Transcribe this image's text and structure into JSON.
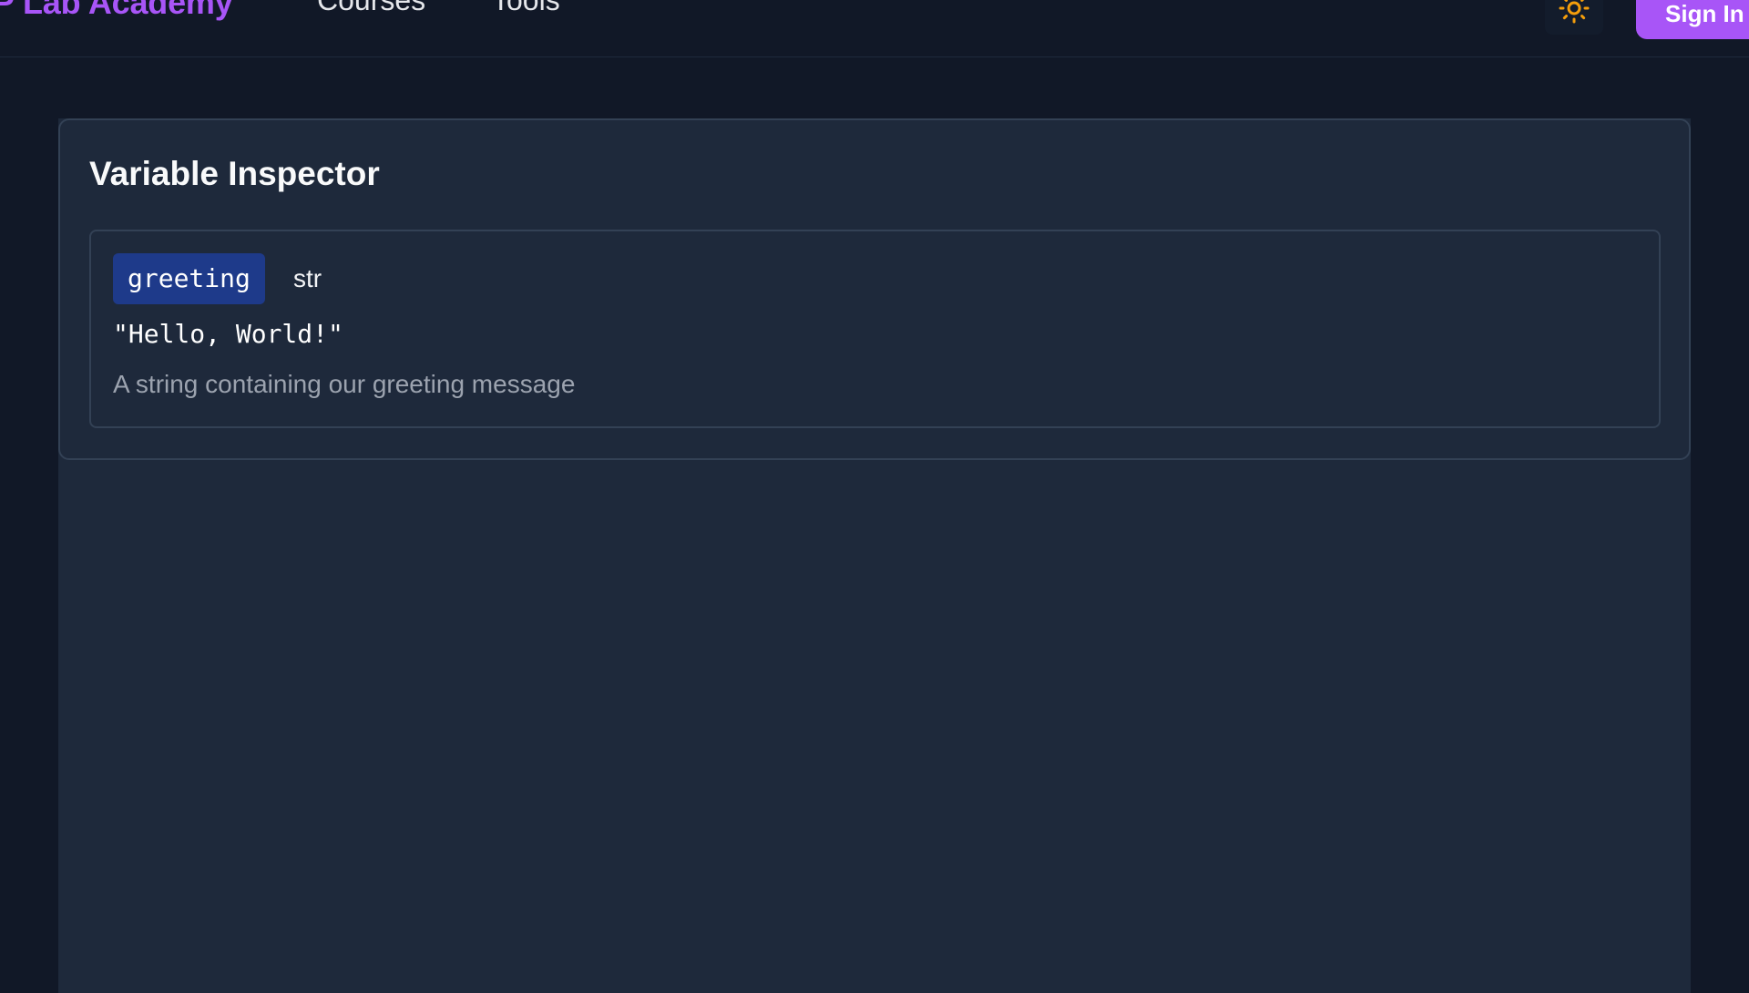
{
  "header": {
    "brand": "P Lab Academy",
    "nav": {
      "courses": "Courses",
      "tools": "Tools"
    },
    "theme_toggle_icon": "sun-icon",
    "sign_in_label": "Sign In"
  },
  "colors": {
    "brand": "#a855f7",
    "background": "#111827",
    "card": "#1e293b",
    "variable_badge": "#1e3a8a",
    "sun_icon": "#f59e0b"
  },
  "inspector": {
    "title": "Variable Inspector",
    "variables": [
      {
        "name": "greeting",
        "type": "str",
        "value": "\"Hello, World!\"",
        "description": "A string containing our greeting message"
      }
    ]
  }
}
